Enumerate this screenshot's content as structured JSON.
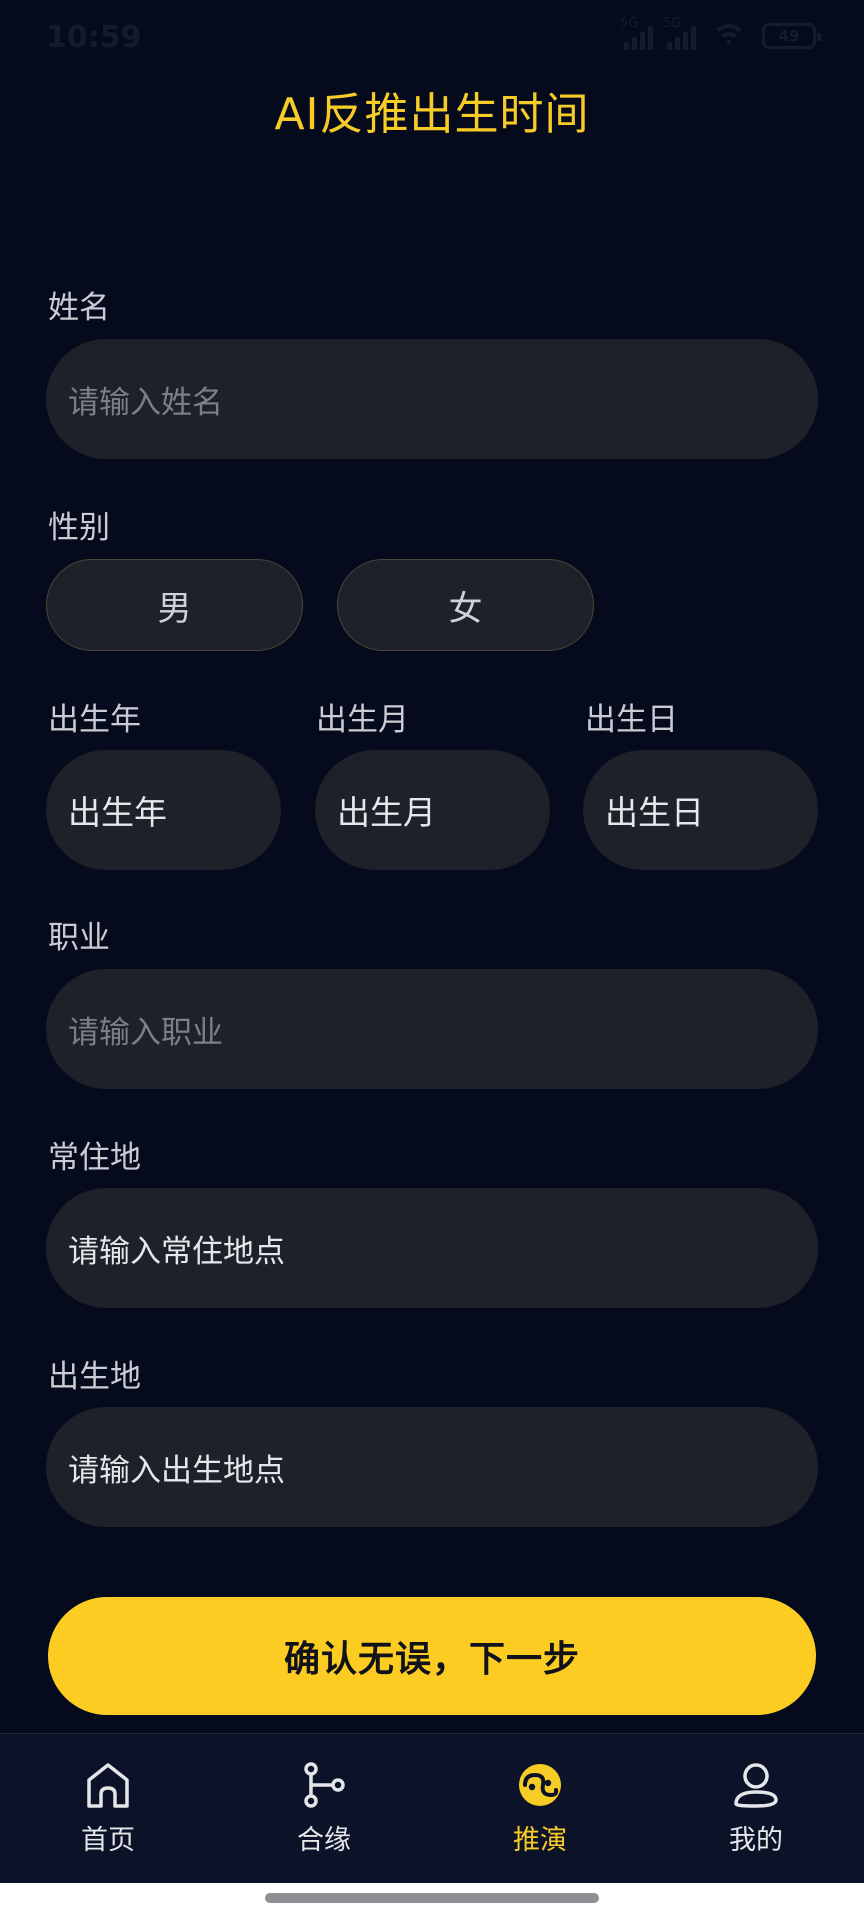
{
  "status_bar": {
    "time": "10:59",
    "network_1": "5G",
    "network_2": "5G",
    "battery": "49"
  },
  "page": {
    "title": "AI反推出生时间"
  },
  "form": {
    "name": {
      "label": "姓名",
      "placeholder": "请输入姓名"
    },
    "gender": {
      "label": "性别",
      "options": [
        "男",
        "女"
      ]
    },
    "birth_year": {
      "label": "出生年",
      "value": "出生年"
    },
    "birth_month": {
      "label": "出生月",
      "value": "出生月"
    },
    "birth_day": {
      "label": "出生日",
      "value": "出生日"
    },
    "occupation": {
      "label": "职业",
      "placeholder": "请输入职业"
    },
    "residence": {
      "label": "常住地",
      "value": "请输入常住地点"
    },
    "birthplace": {
      "label": "出生地",
      "value": "请输入出生地点"
    }
  },
  "confirm_button": {
    "label": "确认无误，下一步"
  },
  "tab_bar": {
    "tabs": [
      {
        "label": "首页",
        "icon": "home-icon"
      },
      {
        "label": "合缘",
        "icon": "branch-icon"
      },
      {
        "label": "推演",
        "icon": "yin-yang-icon",
        "active": true
      },
      {
        "label": "我的",
        "icon": "user-icon"
      }
    ]
  },
  "colors": {
    "background": "#050b1c",
    "accent": "#f8cc27",
    "button": "#fccc22",
    "field": "#1e2129"
  }
}
